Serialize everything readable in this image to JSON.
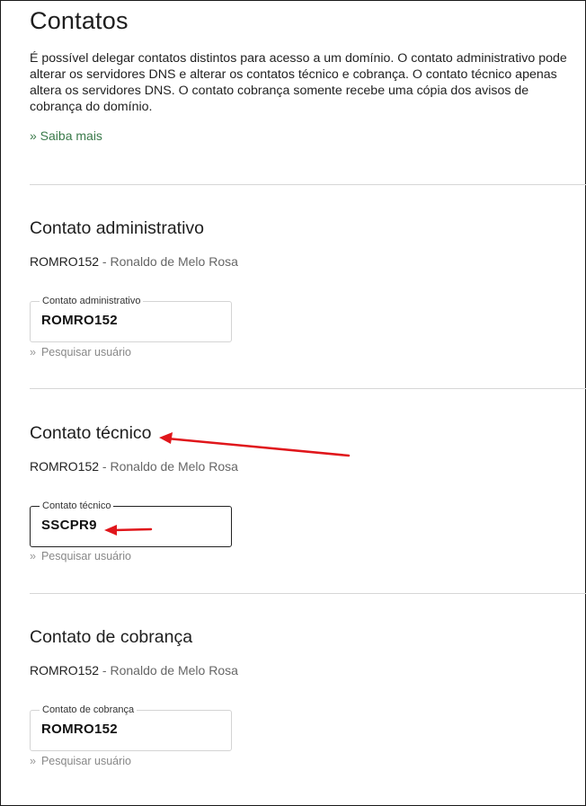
{
  "page": {
    "title": "Contatos",
    "intro": "É possível delegar contatos distintos para acesso a um domínio. O contato administrativo pode alterar os servidores DNS e alterar os contatos técnico e cobrança. O contato técnico apenas altera os servidores DNS. O contato cobrança somente recebe uma cópia dos avisos de cobrança do domínio.",
    "learn_more": "» Saiba mais"
  },
  "sections": [
    {
      "title": "Contato administrativo",
      "current_handle": "ROMRO152",
      "separator": " - ",
      "current_name": "Ronaldo de Melo Rosa",
      "field_label": "Contato administrativo",
      "field_value": "ROMRO152",
      "search_chevron": "»",
      "search_label": "Pesquisar usuário"
    },
    {
      "title": "Contato técnico",
      "current_handle": "ROMRO152",
      "separator": " - ",
      "current_name": "Ronaldo de Melo Rosa",
      "field_label": "Contato técnico",
      "field_value": "SSCPR9",
      "search_chevron": "»",
      "search_label": "Pesquisar usuário"
    },
    {
      "title": "Contato de cobrança",
      "current_handle": "ROMRO152",
      "separator": " - ",
      "current_name": "Ronaldo de Melo Rosa",
      "field_label": "Contato de cobrança",
      "field_value": "ROMRO152",
      "search_chevron": "»",
      "search_label": "Pesquisar usuário"
    }
  ],
  "colors": {
    "link_green": "#3a7a4a",
    "annotation_arrow": "#e0161b"
  }
}
